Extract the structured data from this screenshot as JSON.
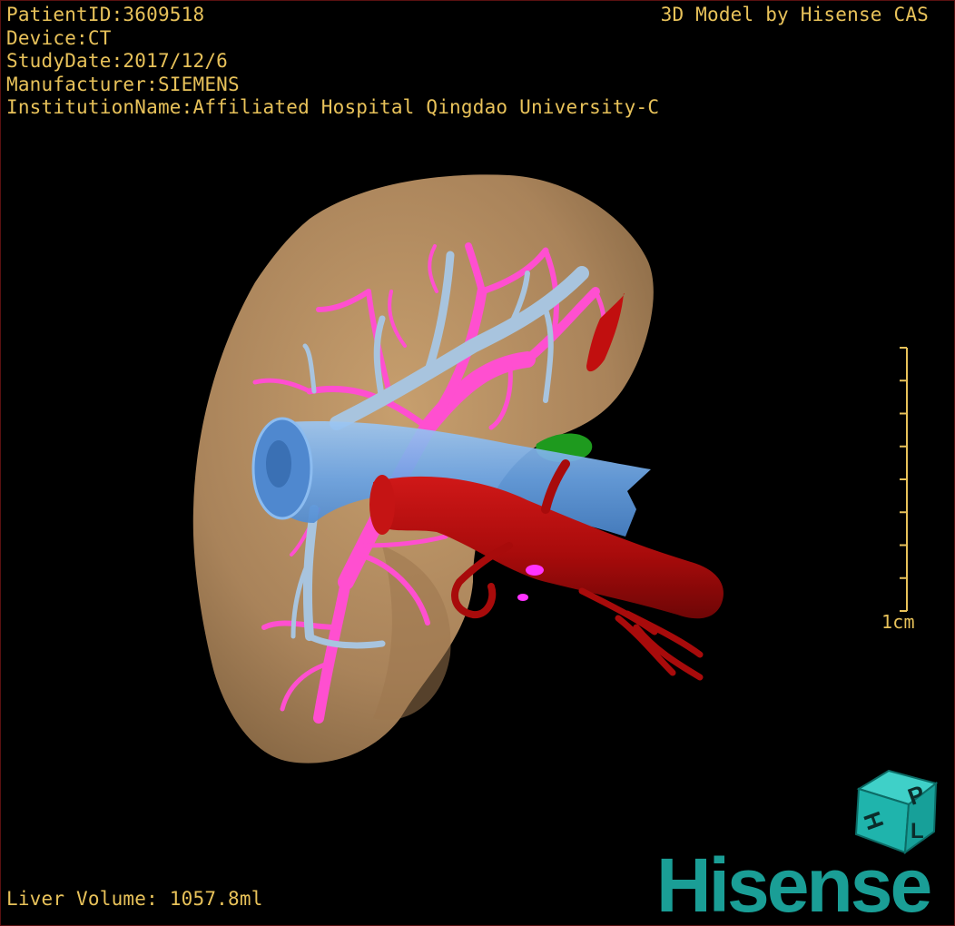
{
  "header": {
    "patient_id": "PatientID:3609518",
    "device": "Device:CT",
    "study_date": "StudyDate:2017/12/6",
    "manufacturer": "Manufacturer:SIEMENS",
    "institution": "InstitutionName:Affiliated Hospital Qingdao University-C",
    "model_credit": "3D Model by Hisense CAS"
  },
  "footer": {
    "liver_volume": "Liver Volume: 1057.8ml"
  },
  "scale_bar": {
    "label": "1cm",
    "tick_count": 9
  },
  "logo": {
    "brand": "Hisense",
    "cube_letters": [
      "H",
      "P",
      "L"
    ]
  },
  "colors": {
    "overlay_text": "#e8c25a",
    "liver": "#b08a5c",
    "portal_vein": "#ff4fd0",
    "hepatic_vein": "#a8c4de",
    "ivc": "#6ea8ec",
    "artery": "#b80c0c",
    "gallbladder": "#1e9a1e",
    "brand": "#1a9e96"
  }
}
